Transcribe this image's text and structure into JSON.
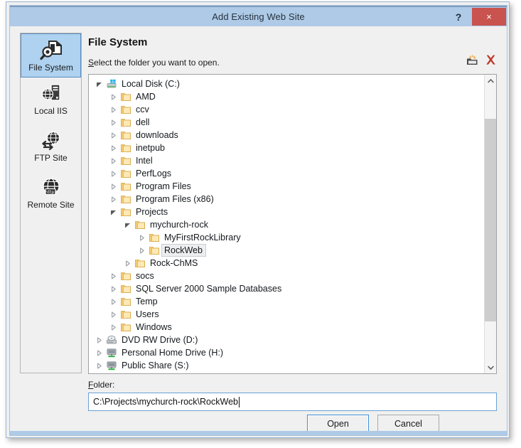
{
  "window": {
    "title": "Add Existing Web Site",
    "help_label": "?",
    "close_label": "×"
  },
  "sidebar": {
    "items": [
      {
        "label": "File System",
        "icon": "file-system-icon",
        "selected": true
      },
      {
        "label": "Local IIS",
        "icon": "local-iis-icon",
        "selected": false
      },
      {
        "label": "FTP Site",
        "icon": "ftp-site-icon",
        "selected": false
      },
      {
        "label": "Remote Site",
        "icon": "remote-site-icon",
        "selected": false
      }
    ]
  },
  "panel": {
    "title": "File System",
    "subtitle_accel": "S",
    "subtitle_rest": "elect the folder you want to open.",
    "tools": [
      {
        "name": "new-folder-icon",
        "tooltip": "New Folder"
      },
      {
        "name": "delete-icon",
        "tooltip": "Delete"
      }
    ]
  },
  "tree": {
    "rows": [
      {
        "label": "Local Disk (C:)",
        "depth": 0,
        "icon": "hard-drive-icon",
        "state": "expanded",
        "selected": false
      },
      {
        "label": "AMD",
        "depth": 1,
        "icon": "folder-icon",
        "state": "collapsed",
        "selected": false
      },
      {
        "label": "ccv",
        "depth": 1,
        "icon": "folder-icon",
        "state": "collapsed",
        "selected": false
      },
      {
        "label": "dell",
        "depth": 1,
        "icon": "folder-icon",
        "state": "collapsed",
        "selected": false
      },
      {
        "label": "downloads",
        "depth": 1,
        "icon": "folder-icon",
        "state": "collapsed",
        "selected": false
      },
      {
        "label": "inetpub",
        "depth": 1,
        "icon": "folder-icon",
        "state": "collapsed",
        "selected": false
      },
      {
        "label": "Intel",
        "depth": 1,
        "icon": "folder-icon",
        "state": "collapsed",
        "selected": false
      },
      {
        "label": "PerfLogs",
        "depth": 1,
        "icon": "folder-icon",
        "state": "collapsed",
        "selected": false
      },
      {
        "label": "Program Files",
        "depth": 1,
        "icon": "folder-icon",
        "state": "collapsed",
        "selected": false
      },
      {
        "label": "Program Files (x86)",
        "depth": 1,
        "icon": "folder-icon",
        "state": "collapsed",
        "selected": false
      },
      {
        "label": "Projects",
        "depth": 1,
        "icon": "folder-icon",
        "state": "expanded",
        "selected": false
      },
      {
        "label": "mychurch-rock",
        "depth": 2,
        "icon": "folder-icon",
        "state": "expanded",
        "selected": false
      },
      {
        "label": "MyFirstRockLibrary",
        "depth": 3,
        "icon": "folder-icon",
        "state": "collapsed",
        "selected": false
      },
      {
        "label": "RockWeb",
        "depth": 3,
        "icon": "folder-icon",
        "state": "collapsed",
        "selected": true
      },
      {
        "label": "Rock-ChMS",
        "depth": 2,
        "icon": "folder-icon",
        "state": "collapsed",
        "selected": false
      },
      {
        "label": "socs",
        "depth": 1,
        "icon": "folder-icon",
        "state": "collapsed",
        "selected": false
      },
      {
        "label": "SQL Server 2000 Sample Databases",
        "depth": 1,
        "icon": "folder-icon",
        "state": "collapsed",
        "selected": false
      },
      {
        "label": "Temp",
        "depth": 1,
        "icon": "folder-icon",
        "state": "collapsed",
        "selected": false
      },
      {
        "label": "Users",
        "depth": 1,
        "icon": "folder-icon",
        "state": "collapsed",
        "selected": false
      },
      {
        "label": "Windows",
        "depth": 1,
        "icon": "folder-icon",
        "state": "collapsed",
        "selected": false
      },
      {
        "label": "DVD RW Drive (D:)",
        "depth": 0,
        "icon": "optical-drive-icon",
        "state": "collapsed",
        "selected": false
      },
      {
        "label": "Personal Home Drive (H:)",
        "depth": 0,
        "icon": "network-drive-icon",
        "state": "collapsed",
        "selected": false
      },
      {
        "label": "Public Share (S:)",
        "depth": 0,
        "icon": "network-drive-icon",
        "state": "collapsed",
        "selected": false
      }
    ]
  },
  "folder": {
    "label_accel": "F",
    "label_rest": "older:",
    "value": "C:\\Projects\\mychurch-rock\\RockWeb"
  },
  "buttons": {
    "open": "Open",
    "cancel": "Cancel"
  },
  "colors": {
    "titlebar": "#aecae7",
    "close_button": "#c9534f",
    "selection": "#aed2f0",
    "focus_border": "#3f8fd6",
    "folder_yellow": "#ffd37a",
    "delete_red": "#c0392b"
  }
}
